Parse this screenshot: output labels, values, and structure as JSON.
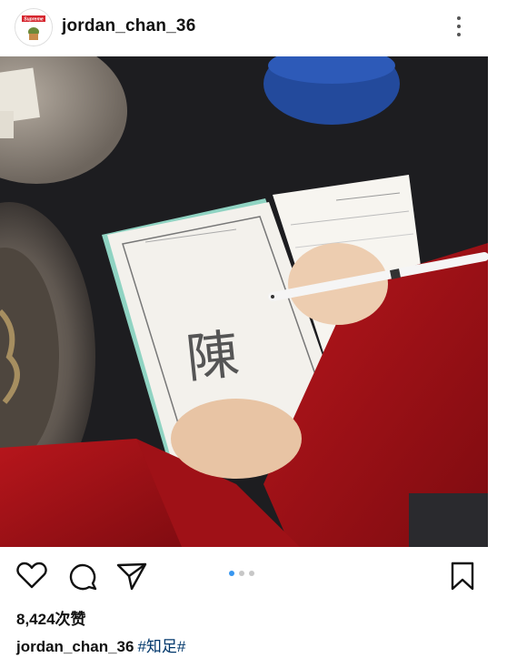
{
  "post": {
    "username": "jordan_chan_36",
    "avatar_badge": "Supreme",
    "likes_text": "8,424次赞",
    "caption_user": "jordan_chan_36",
    "caption_tag": "#知足#",
    "handwritten_char": "陳"
  },
  "carousel": {
    "count": 3,
    "active_index": 0
  },
  "icons": {
    "more": "more-vertical-icon",
    "like": "heart-icon",
    "comment": "comment-icon",
    "share": "send-icon",
    "save": "bookmark-icon"
  },
  "colors": {
    "accent": "#3897f0",
    "dot_inactive": "#c7c7c7",
    "hashtag": "#00376b",
    "badge_red": "#d6262f"
  }
}
